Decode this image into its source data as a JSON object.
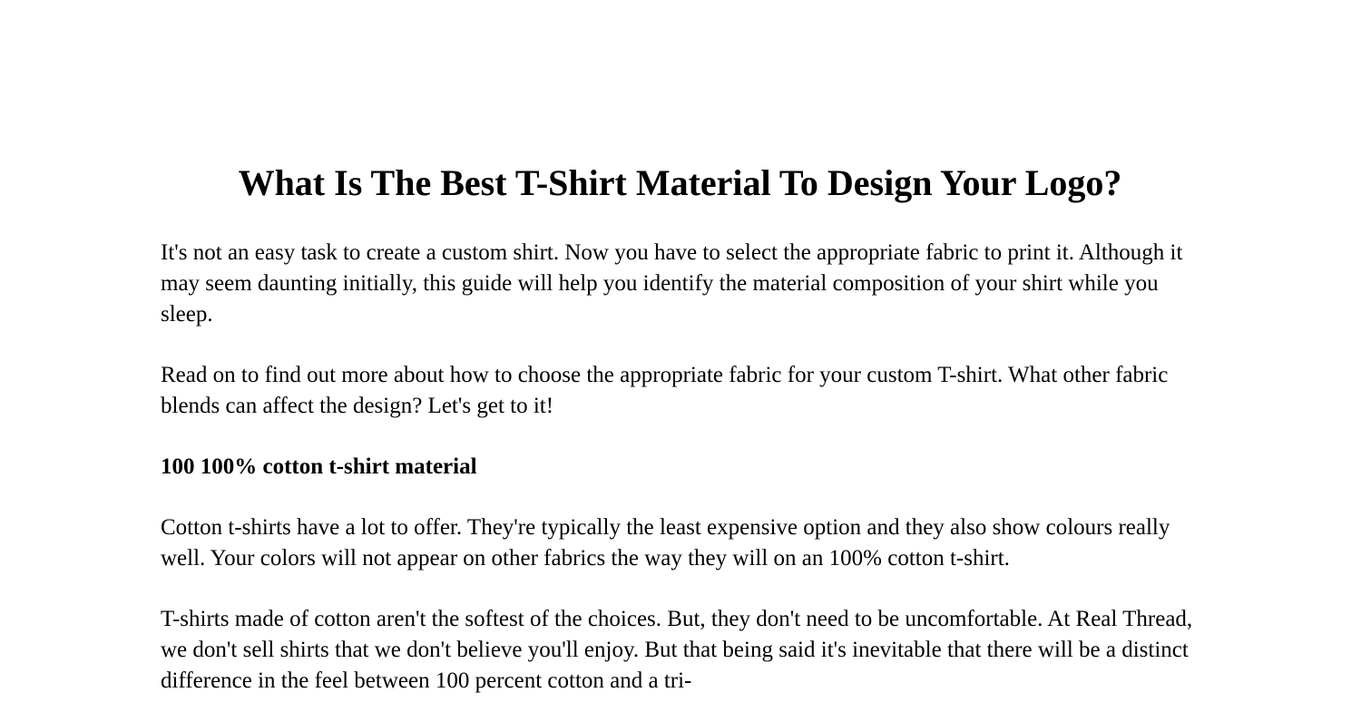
{
  "document": {
    "title": "What Is The Best T-Shirt Material To Design Your Logo?",
    "blocks": {
      "paragraph_1": "It's not an easy task to create a custom shirt. Now you have to select the appropriate fabric to print it. Although it may seem daunting initially, this guide will help you identify the material composition of your shirt while you sleep.",
      "paragraph_2": "Read on to find out more about how to choose the appropriate fabric for your custom T-shirt. What other fabric blends can affect the design? Let's get to it!",
      "subheading_1": "100 100% cotton t-shirt material",
      "paragraph_3": "Cotton t-shirts have a lot to offer. They're typically the least expensive option and they also show colours really well. Your colors will not appear on other fabrics the way they will on an 100% cotton t-shirt.",
      "paragraph_4": "T-shirts made of cotton aren't the softest of the choices. But, they don't need to be uncomfortable. At Real Thread, we don't sell shirts that we don't believe you'll enjoy. But that being said it's inevitable that there will be a distinct difference in the feel between 100 percent cotton and a tri-"
    }
  },
  "colors": {
    "page_background": "#ffffff",
    "text": "#000000"
  }
}
